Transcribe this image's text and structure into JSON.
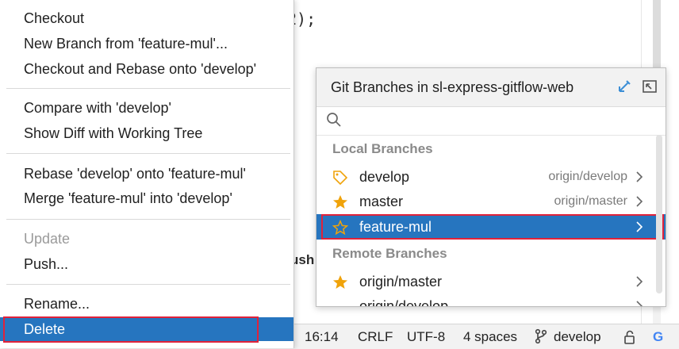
{
  "editor": {
    "code_fragment": "2);",
    "bg_tool_text": "ush"
  },
  "context_menu": {
    "groups": [
      [
        {
          "label": "Checkout",
          "enabled": true
        },
        {
          "label": "New Branch from 'feature-mul'...",
          "enabled": true
        },
        {
          "label": "Checkout and Rebase onto 'develop'",
          "enabled": true
        }
      ],
      [
        {
          "label": "Compare with 'develop'",
          "enabled": true
        },
        {
          "label": "Show Diff with Working Tree",
          "enabled": true
        }
      ],
      [
        {
          "label": "Rebase 'develop' onto 'feature-mul'",
          "enabled": true
        },
        {
          "label": "Merge 'feature-mul' into 'develop'",
          "enabled": true
        }
      ],
      [
        {
          "label": "Update",
          "enabled": false
        },
        {
          "label": "Push...",
          "enabled": true
        }
      ],
      [
        {
          "label": "Rename...",
          "enabled": true
        },
        {
          "label": "Delete",
          "enabled": true,
          "selected": true
        }
      ]
    ]
  },
  "git_popup": {
    "title": "Git Branches in sl-express-gitflow-web",
    "search_placeholder": "",
    "local_header": "Local Branches",
    "remote_header": "Remote Branches",
    "local_branches": [
      {
        "name": "develop",
        "tracking": "origin/develop",
        "icon": "tag-icon"
      },
      {
        "name": "master",
        "tracking": "origin/master",
        "icon": "star-filled-icon"
      },
      {
        "name": "feature-mul",
        "tracking": "",
        "icon": "star-outline-icon",
        "selected": true
      }
    ],
    "remote_branches": [
      {
        "name": "origin/master",
        "icon": "star-filled-icon"
      },
      {
        "name": "origin/develop",
        "icon": ""
      }
    ]
  },
  "status_bar": {
    "position": "16:14",
    "line_separator": "CRLF",
    "encoding": "UTF-8",
    "indent": "4 spaces",
    "branch": "develop",
    "g_label": "G"
  },
  "colors": {
    "selection": "#2675bf",
    "highlight_box": "#e0223a",
    "star": "#f0a30a"
  }
}
